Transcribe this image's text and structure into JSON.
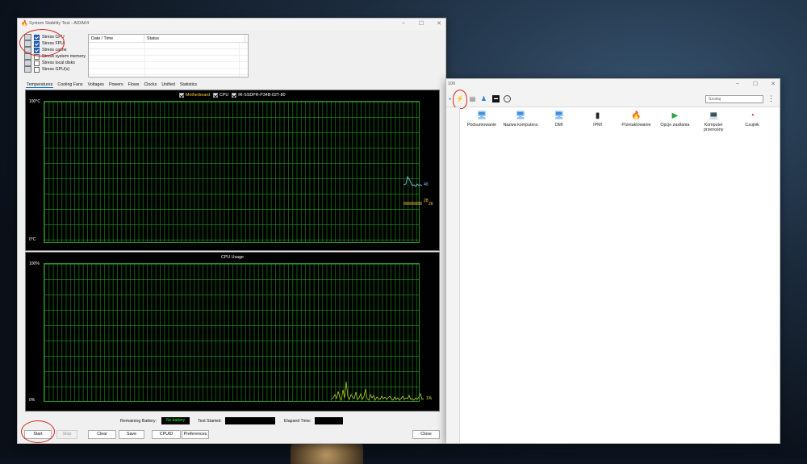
{
  "main_window": {
    "title": "System Stability Test - AIDA64",
    "window_buttons": [
      "–",
      "☐",
      "✕"
    ],
    "stress_options": [
      {
        "label": "Stress CPU",
        "checked": true
      },
      {
        "label": "Stress FPU",
        "checked": true
      },
      {
        "label": "Stress cache",
        "checked": true
      },
      {
        "label": "Stress system memory",
        "checked": false
      },
      {
        "label": "Stress local disks",
        "checked": false
      },
      {
        "label": "Stress GPU(s)",
        "checked": false
      }
    ],
    "log_headers": [
      "Date / Time",
      "Status"
    ],
    "tabs": [
      "Temperatures",
      "Cooling Fans",
      "Voltages",
      "Powers",
      "Flows",
      "Clocks",
      "Unified",
      "Statistics"
    ],
    "active_tab": "Temperatures",
    "temperature_graph": {
      "ymax_label": "100°C",
      "ymin_label": "0°C",
      "legend": [
        {
          "label": "Motherboard",
          "color": "#ffd23c",
          "checked": true
        },
        {
          "label": "CPU",
          "color": "#ffffff",
          "checked": true
        },
        {
          "label": "IR-SSDPR-P34B-02T-80",
          "color": "#ffffff",
          "checked": true
        }
      ],
      "values": [
        {
          "label": "40",
          "color": "#7fd6ff"
        },
        {
          "label": "28",
          "color": "#ffd23c"
        },
        {
          "label": "26",
          "color": "#ffd23c"
        }
      ]
    },
    "cpu_graph": {
      "title": "CPU Usage",
      "ymax_label": "100%",
      "ymin_label": "0%",
      "value_label": "1%",
      "line_color": "#c8e61e"
    },
    "status": {
      "remaining_battery_label": "Remaining Battery:",
      "remaining_battery_value": "No battery",
      "test_started_label": "Test Started:",
      "test_started_value": "",
      "elapsed_time_label": "Elapsed Time:",
      "elapsed_time_value": ""
    },
    "buttons": {
      "start": "Start",
      "stop": "Stop",
      "clear": "Clear",
      "save": "Save",
      "cpuid": "CPUID",
      "preferences": "Preferences",
      "close": "Close"
    }
  },
  "second_window": {
    "title_fragment": "100",
    "window_buttons": [
      "–",
      "☐",
      "✕"
    ],
    "search_placeholder": "Szukaj",
    "items": [
      {
        "label": "Podsumowanie",
        "icon": "computer-icon"
      },
      {
        "label": "Nazwa komputera",
        "icon": "computer-icon"
      },
      {
        "label": "DMI",
        "icon": "computer-icon"
      },
      {
        "label": "IPMI",
        "icon": "server-icon"
      },
      {
        "label": "Przetaktowanie",
        "icon": "flame-icon"
      },
      {
        "label": "Opcje zasilania",
        "icon": "power-icon"
      },
      {
        "label": "Komputer przenośny",
        "icon": "laptop-icon"
      },
      {
        "label": "Czujnik",
        "icon": "gauge-icon"
      }
    ]
  },
  "colors": {
    "annotation_red": "#e0251b",
    "grid_green": "#2c8a2c",
    "checkbox_blue": "#2266cc"
  }
}
